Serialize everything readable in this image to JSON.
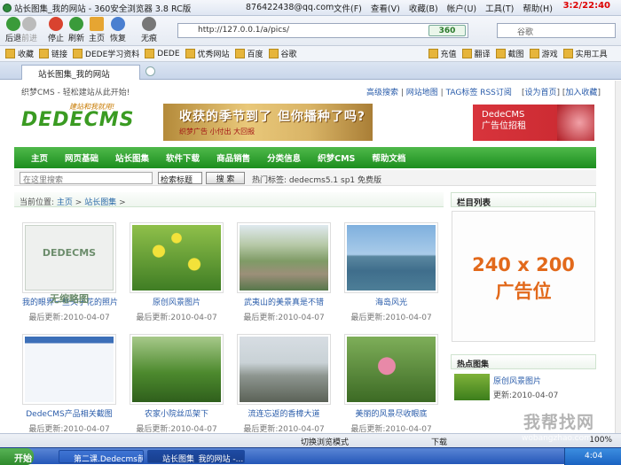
{
  "window": {
    "title": "站长图集_我的网站 - 360安全浏览器 3.8 RC版",
    "email": "876422438@qq.com",
    "menus": [
      "文件(F)",
      "查看(V)",
      "收藏(B)",
      "帐户(U)",
      "工具(T)",
      "帮助(H)"
    ],
    "clock": "3:2/22:40"
  },
  "nav": {
    "back": "后退",
    "forward": "前进",
    "stop": "停止",
    "refresh": "刷新",
    "home": "主页",
    "restore": "恢复",
    "noimg": "无痕",
    "address": "http://127.0.0.1/a/pics/",
    "engine": "360",
    "search_placeholder": "谷歌"
  },
  "favorites": {
    "label": "收藏",
    "items": [
      "链接",
      "DEDE学习资料",
      "DEDE",
      "优秀网站",
      "百度",
      "谷歌"
    ],
    "right": [
      "充值",
      "翻译",
      "截图",
      "游戏",
      "实用工具"
    ]
  },
  "tab": {
    "title": "站长图集_我的网站"
  },
  "site": {
    "slogan": "织梦CMS - 轻松建站从此开始!",
    "toplinks": [
      "高级搜索",
      "网站地图",
      "TAG标签",
      "RSS订阅"
    ],
    "toplinks_right": [
      "设为首页",
      "加入收藏"
    ],
    "logo_text": "DEDECMS",
    "logo_sub": "建站和我就用!",
    "banner1": {
      "title": "收获的季节到了 但你播种了吗?",
      "sub": "织梦广告 小付出 大回报"
    },
    "banner2": {
      "line1": "DedeCMS",
      "line2": "广告位招租"
    },
    "menu": [
      "主页",
      "网页基础",
      "站长图集",
      "软件下载",
      "商品销售",
      "分类信息",
      "织梦CMS",
      "帮助文档"
    ],
    "search": {
      "placeholder": "在这里搜索",
      "select": "检索标题",
      "button": "搜 索",
      "hot_label": "热门标签:",
      "hot_tags": "dedecms5.1 sp1 免费版"
    },
    "breadcrumb": {
      "label": "当前位置:",
      "home": "主页",
      "current": "站长图集"
    },
    "sidebar": {
      "col_title": "栏目列表",
      "ad_size": "240 x 200",
      "ad_text": "广告位",
      "hot_title": "热点图集",
      "hot_item": "原创风景图片",
      "hot_date": "更新:2010-04-07"
    },
    "cards": [
      {
        "title": "我的眼界一些关于花的照片",
        "date": "最后更新:2010-04-07",
        "ph1": "DEDECMS",
        "ph2": "无缩略图"
      },
      {
        "title": "原创风景图片",
        "date": "最后更新:2010-04-07"
      },
      {
        "title": "武夷山的美景真是不错",
        "date": "最后更新:2010-04-07"
      },
      {
        "title": "海岛风光",
        "date": "最后更新:2010-04-07"
      },
      {
        "title": "DedeCMS产品相关截图",
        "date": "最后更新:2010-04-07"
      },
      {
        "title": "农家小院丝瓜架下",
        "date": "最后更新:2010-04-07"
      },
      {
        "title": "流连忘返的香樟大道",
        "date": "最后更新:2010-04-07"
      },
      {
        "title": "美丽的风景尽收眼底",
        "date": "最后更新:2010-04-07"
      }
    ]
  },
  "status": {
    "switch": "切换浏览模式",
    "download": "下载",
    "zoom": "100%"
  },
  "taskbar": {
    "start": "开始",
    "items": [
      "第二课.Dedecms前台...",
      "站长图集_我的网站 -..."
    ],
    "time": "4:04"
  },
  "watermark": {
    "text": "我帮找网",
    "url": "wobangzhao.com"
  }
}
